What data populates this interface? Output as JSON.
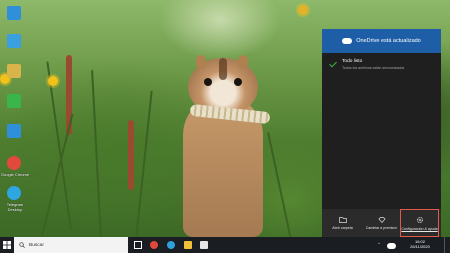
{
  "desktop": {
    "icons": [
      {
        "label": "",
        "color": "#2f8fd8"
      },
      {
        "label": "",
        "color": "#3aa0e0"
      },
      {
        "label": "",
        "color": "#d9b44a"
      },
      {
        "label": "",
        "color": "#39b54a"
      },
      {
        "label": "",
        "color": "#2f8fd8"
      },
      {
        "label": "Google Chrome",
        "color": "#e0493b"
      },
      {
        "label": "Telegram Desktop",
        "color": "#2ea6e0"
      }
    ]
  },
  "onedrive": {
    "title": "OneDrive está actualizado",
    "status_title": "Todo listo",
    "status_desc": "Todos los archivos están sincronizados",
    "footer": [
      {
        "label": "Abrir carpeta",
        "icon": "folder-icon"
      },
      {
        "label": "Cambiar a premium",
        "icon": "diamond-icon"
      },
      {
        "label": "Configuración & ayuda",
        "icon": "gear-icon"
      }
    ],
    "accent": "#1d5ea6"
  },
  "taskbar": {
    "search_placeholder": "Buscar",
    "time": "16:02",
    "date": "26/11/2020",
    "pinned": [
      {
        "name": "task-view-icon",
        "color": "#ffffff"
      },
      {
        "name": "edge-icon",
        "color": "#2fa0de"
      },
      {
        "name": "file-explorer-icon",
        "color": "#f0c23a"
      },
      {
        "name": "store-icon",
        "color": "#e6e6e6"
      },
      {
        "name": "chrome-icon",
        "color": "#e0493b"
      }
    ]
  }
}
